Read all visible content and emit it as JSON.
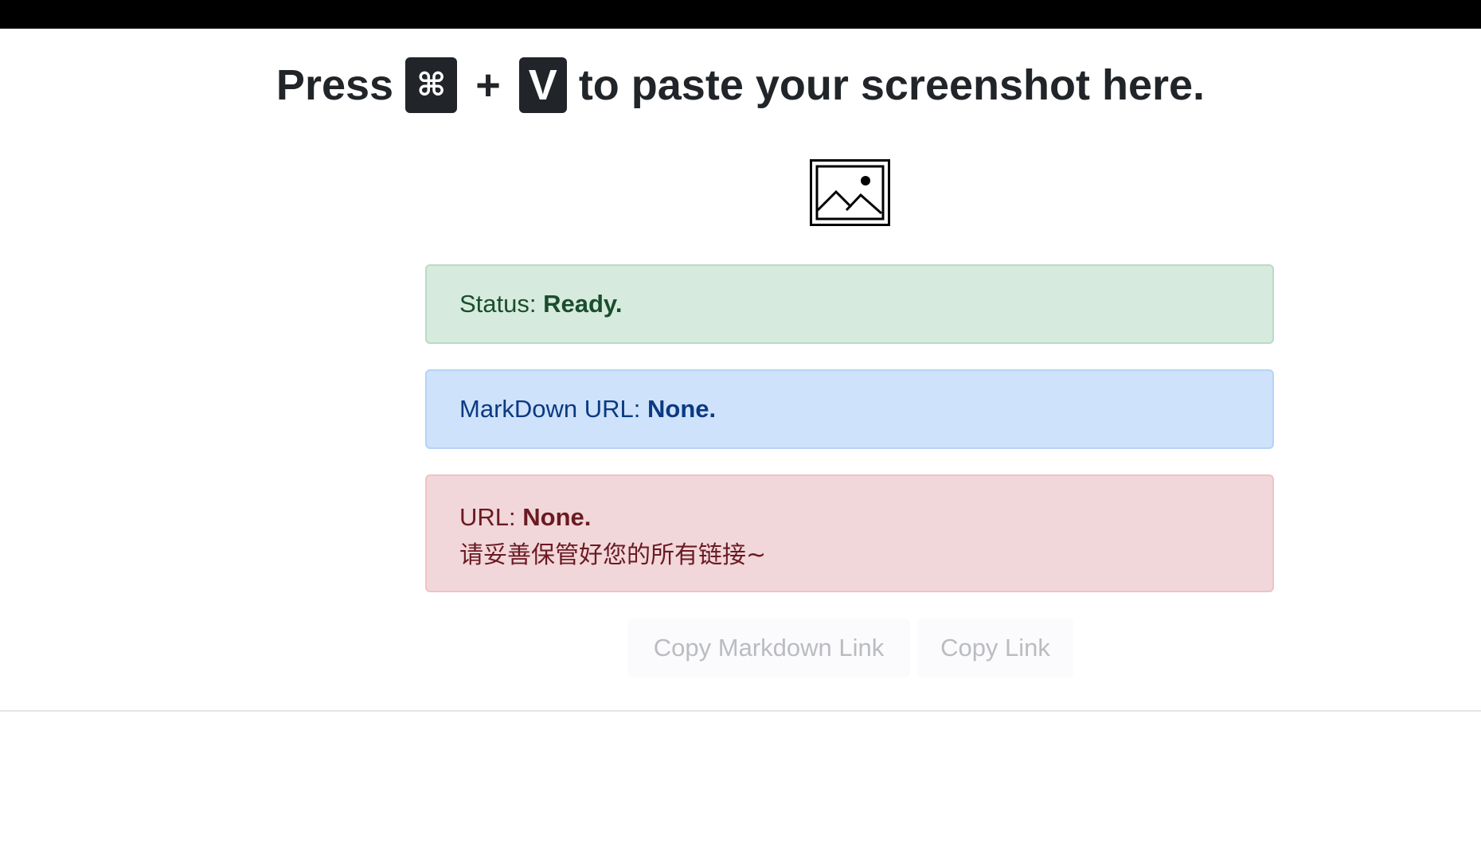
{
  "header": {
    "text_press": "Press",
    "key_cmd": "⌘",
    "plus": "+",
    "key_v": "V",
    "text_rest": "to paste your screenshot here."
  },
  "placeholder_icon": "image-icon",
  "status": {
    "label": "Status:",
    "value": "Ready."
  },
  "markdown_url": {
    "label": "MarkDown URL:",
    "value": "None."
  },
  "url": {
    "label": "URL:",
    "value": "None.",
    "note": "请妥善保管好您的所有链接~"
  },
  "buttons": {
    "copy_markdown": "Copy Markdown Link",
    "copy_link": "Copy Link"
  },
  "colors": {
    "success_bg": "#d6ebdd",
    "info_bg": "#cfe2fb",
    "danger_bg": "#f1d7da",
    "kbd_bg": "#212529"
  }
}
